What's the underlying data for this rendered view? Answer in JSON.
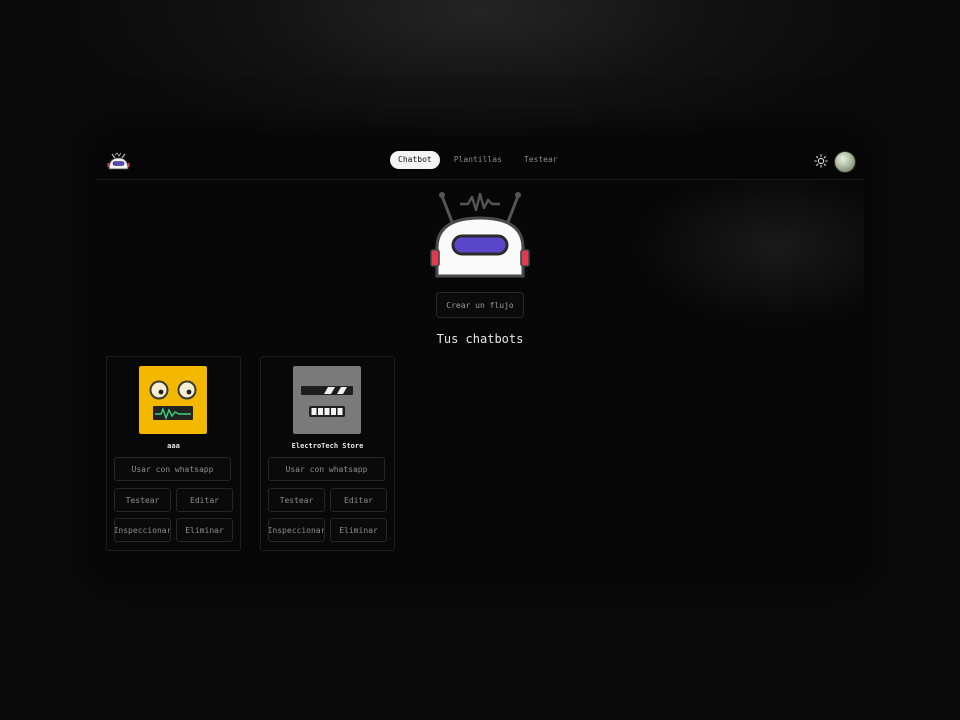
{
  "header": {
    "logo_icon": "robot-logo-icon",
    "tabs": [
      {
        "label": "Chatbot",
        "active": true
      },
      {
        "label": "Plantillas",
        "active": false
      },
      {
        "label": "Testear",
        "active": false
      }
    ],
    "theme_icon": "sun-icon",
    "avatar_icon": "user-avatar"
  },
  "main": {
    "hero_icon": "robot-mascot-icon",
    "create_label": "Crear un flujo",
    "section_title": "Tus chatbots"
  },
  "chatbots": [
    {
      "name": "aaa",
      "avatar_color": "#f5b800",
      "buttons": {
        "whatsapp": "Usar con whatsapp",
        "test": "Testear",
        "edit": "Editar",
        "inspect": "Inspeccionar",
        "delete": "Eliminar"
      }
    },
    {
      "name": "ElectroTech Store",
      "avatar_color": "#7a7a7a",
      "buttons": {
        "whatsapp": "Usar con whatsapp",
        "test": "Testear",
        "edit": "Editar",
        "inspect": "Inspeccionar",
        "delete": "Eliminar"
      }
    }
  ],
  "colors": {
    "accent_purple": "#5a46c8",
    "robot_red": "#e03c50",
    "tab_active_bg": "#f4f4f4"
  }
}
